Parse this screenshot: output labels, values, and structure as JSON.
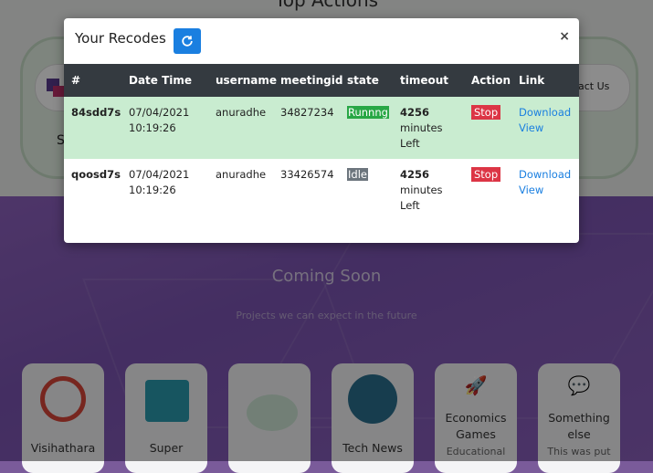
{
  "background": {
    "top_title": "Top Actions",
    "card_letter": "S",
    "contact_label": "act Us",
    "coming_soon": "Coming Soon",
    "projects_subtitle": "Projects we can expect in the future",
    "tiles": [
      {
        "line1": "Visihathara",
        "line2": ""
      },
      {
        "line1": "Super",
        "line2": ""
      },
      {
        "line1": "",
        "line2": ""
      },
      {
        "line1": "Tech News",
        "line2": ""
      },
      {
        "line1": "Economics",
        "line2": "Games",
        "line3": "Educational"
      },
      {
        "line1": "Something",
        "line2": "else",
        "line3": "This was put"
      }
    ]
  },
  "modal": {
    "title": "Your Recodes",
    "refresh_icon": "refresh-icon",
    "close_label": "×",
    "columns": [
      "#",
      "Date Time",
      "username",
      "meetingid",
      "state",
      "timeout",
      "Action",
      "Link"
    ],
    "rows": [
      {
        "id": "84sdd7s",
        "date": "07/04/2021",
        "time": "10:19:26",
        "username": "anuradhe",
        "meetingid": "34827234",
        "state": "Runnng",
        "timeout_value": "4256",
        "timeout_unit": "minutes",
        "timeout_suffix": "Left",
        "action": "Stop",
        "link_download": "Download",
        "link_view": "View"
      },
      {
        "id": "qoosd7s",
        "date": "07/04/2021",
        "time": "10:19:26",
        "username": "anuradhe",
        "meetingid": "33426574",
        "state": "Idle",
        "timeout_value": "4256",
        "timeout_unit": "minutes",
        "timeout_suffix": "Left",
        "action": "Stop",
        "link_download": "Download",
        "link_view": "View"
      }
    ]
  },
  "colors": {
    "header_bg": "#343a40",
    "running_row_bg": "#c9ecd0",
    "running_badge": "#28a745",
    "idle_badge": "#6c757d",
    "stop_button": "#dc3545",
    "link": "#1a7fe0",
    "refresh_button": "#1a7fe0"
  }
}
